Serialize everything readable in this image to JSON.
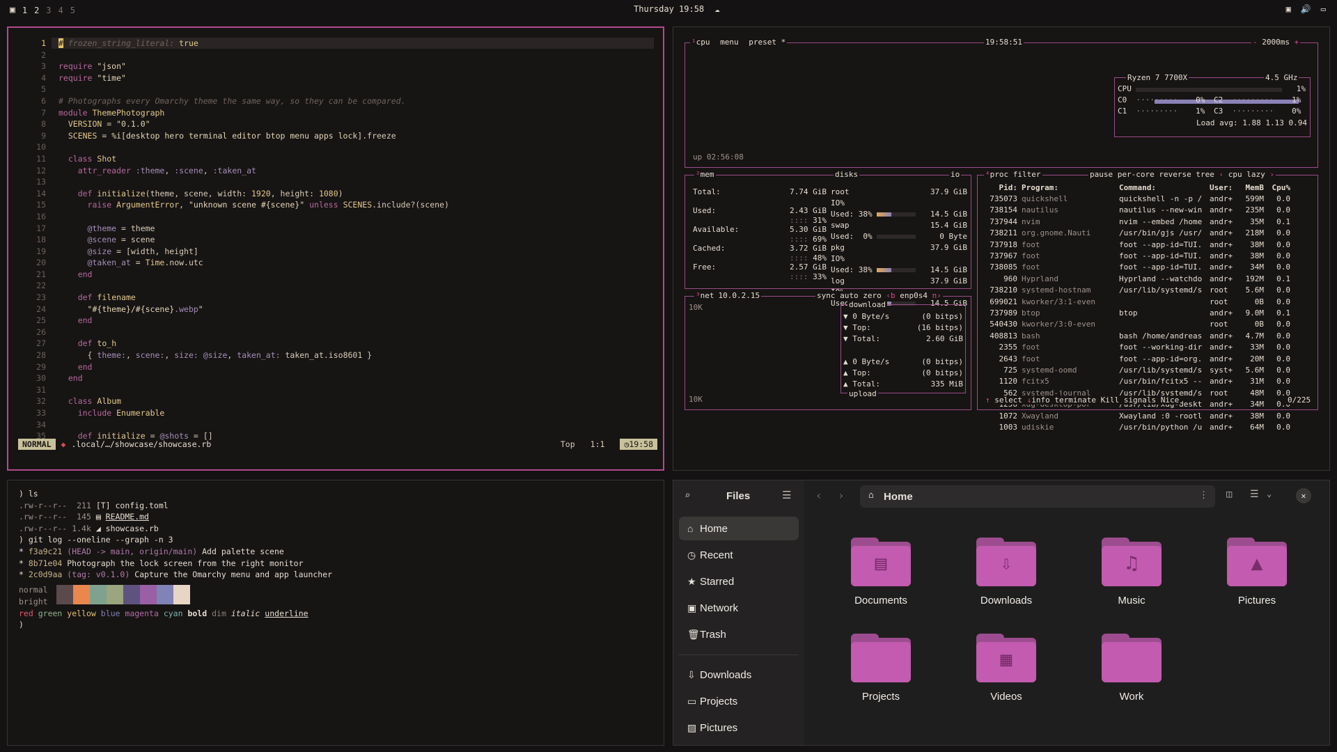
{
  "topbar": {
    "workspaces": [
      "1",
      "2",
      "3",
      "4",
      "5"
    ],
    "clock": "Thursday 19:58"
  },
  "editor": {
    "lines": [
      {
        "n": "1",
        "html": "<span class=\"cm\"># frozen_string_literal:</span> <span class=\"const\">true</span>"
      },
      {
        "n": "2",
        "html": ""
      },
      {
        "n": "3",
        "html": "<span class=\"kw\">require</span> <span class=\"str\">\"json\"</span>"
      },
      {
        "n": "4",
        "html": "<span class=\"kw\">require</span> <span class=\"str\">\"time\"</span>"
      },
      {
        "n": "5",
        "html": ""
      },
      {
        "n": "6",
        "html": "<span class=\"cm\"># Photographs every Omarchy theme the same way, so they can be compared.</span>"
      },
      {
        "n": "7",
        "html": "<span class=\"kw\">module</span> <span class=\"fn\">ThemePhotograph</span>"
      },
      {
        "n": "8",
        "html": "  <span class=\"const\">VERSION</span> = <span class=\"str\">\"0.1.0\"</span>"
      },
      {
        "n": "9",
        "html": "  <span class=\"const\">SCENES</span> = <span class=\"str\">%i[desktop hero terminal editor btop menu apps lock]</span>.freeze"
      },
      {
        "n": "10",
        "html": ""
      },
      {
        "n": "11",
        "html": "  <span class=\"kw\">class</span> <span class=\"fn\">Shot</span>"
      },
      {
        "n": "12",
        "html": "    <span class=\"kw\">attr_reader</span> <span class=\"iv\">:theme</span>, <span class=\"iv\">:scene</span>, <span class=\"iv\">:taken_at</span>"
      },
      {
        "n": "13",
        "html": ""
      },
      {
        "n": "14",
        "html": "    <span class=\"kw\">def</span> <span class=\"fn\">initialize</span>(theme, scene, width: <span class=\"const\">1920</span>, height: <span class=\"const\">1080</span>)"
      },
      {
        "n": "15",
        "html": "      <span class=\"kw\">raise</span> <span class=\"fn\">ArgumentError</span>, <span class=\"str\">\"unknown scene #{scene}\"</span> <span class=\"kw\">unless</span> <span class=\"const\">SCENES</span>.include?(scene)"
      },
      {
        "n": "16",
        "html": ""
      },
      {
        "n": "17",
        "html": "      <span class=\"iv\">@theme</span> = theme"
      },
      {
        "n": "18",
        "html": "      <span class=\"iv\">@scene</span> = scene"
      },
      {
        "n": "19",
        "html": "      <span class=\"iv\">@size</span> = [width, height]"
      },
      {
        "n": "20",
        "html": "      <span class=\"iv\">@taken_at</span> = <span class=\"fn\">Time</span>.now.utc"
      },
      {
        "n": "21",
        "html": "    <span class=\"kw\">end</span>"
      },
      {
        "n": "22",
        "html": ""
      },
      {
        "n": "23",
        "html": "    <span class=\"kw\">def</span> <span class=\"fn\">filename</span>"
      },
      {
        "n": "24",
        "html": "      <span class=\"str\">\"#{theme}/#{scene}</span><span class=\"iv\">.webp</span><span class=\"str\">\"</span>"
      },
      {
        "n": "25",
        "html": "    <span class=\"kw\">end</span>"
      },
      {
        "n": "26",
        "html": ""
      },
      {
        "n": "27",
        "html": "    <span class=\"kw\">def</span> <span class=\"fn\">to_h</span>"
      },
      {
        "n": "28",
        "html": "      { <span class=\"iv\">theme:</span>, <span class=\"iv\">scene:</span>, <span class=\"iv\">size:</span> <span class=\"iv\">@size</span>, <span class=\"iv\">taken_at:</span> taken_at.iso8601 }"
      },
      {
        "n": "29",
        "html": "    <span class=\"kw\">end</span>"
      },
      {
        "n": "30",
        "html": "  <span class=\"kw\">end</span>"
      },
      {
        "n": "31",
        "html": ""
      },
      {
        "n": "32",
        "html": "  <span class=\"kw\">class</span> <span class=\"fn\">Album</span>"
      },
      {
        "n": "33",
        "html": "    <span class=\"kw\">include</span> <span class=\"fn\">Enumerable</span>"
      },
      {
        "n": "34",
        "html": ""
      },
      {
        "n": "35",
        "html": "    <span class=\"kw\">def</span> <span class=\"fn\">initialize</span> = <span class=\"iv\">@shots</span> = []"
      }
    ],
    "status": {
      "mode": "NORMAL",
      "path": ".local/…/showcase/showcase.rb",
      "position": "Top",
      "cursor": "1:1",
      "time": "19:58"
    }
  },
  "btop": {
    "header": {
      "cpu": "cpu",
      "menu": "menu",
      "preset": "preset *",
      "clock": "19:58:51",
      "interval": "2000ms"
    },
    "uptime": "up 02:56:08",
    "cpu": {
      "model": "Ryzen 7 7700X",
      "freq": "4.5 GHz",
      "total_label": "CPU",
      "total_pct": "1%",
      "total_fill": 0.99,
      "cores": [
        {
          "name": "C0",
          "pct": "0%"
        },
        {
          "name": "C1",
          "pct": "1%"
        },
        {
          "name": "C2",
          "pct": "1%"
        },
        {
          "name": "C3",
          "pct": "0%"
        }
      ],
      "load": "Load avg: 1.88 1.13 0.94"
    },
    "mem": {
      "title": "mem",
      "rows": [
        {
          "k": "Total:",
          "v": "7.74 GiB"
        },
        {
          "k": "Used:",
          "v": "2.43 GiB",
          "p": "31%"
        },
        {
          "k": "Available:",
          "v": "5.30 GiB",
          "p": "69%"
        },
        {
          "k": "Cached:",
          "v": "3.72 GiB",
          "p": "48%"
        },
        {
          "k": "Free:",
          "v": "2.57 GiB",
          "p": "33%"
        }
      ]
    },
    "disks": {
      "title": "disks",
      "io_label": "io",
      "groups": [
        {
          "name": "root",
          "size": "37.9 GiB",
          "io": "IO%",
          "used": "Used: 38%",
          "usedv": "14.5 GiB",
          "fill": 0.38
        },
        {
          "name": "swap",
          "size": "15.4 GiB",
          "io": "",
          "used": "Used:  0%",
          "usedv": "0 Byte",
          "fill": 0.0
        },
        {
          "name": "pkg",
          "size": "37.9 GiB",
          "io": "IO%",
          "used": "Used: 38%",
          "usedv": "14.5 GiB",
          "fill": 0.38
        },
        {
          "name": "log",
          "size": "37.9 GiB",
          "io": "IO%",
          "used": "Used: 38%",
          "usedv": "14.5 GiB",
          "fill": 0.38
        }
      ]
    },
    "net": {
      "title": "net",
      "addr": "10.0.2.15",
      "opts": [
        "sync",
        "auto",
        "zero"
      ],
      "iface": "enp0s4",
      "scale_top": "10K",
      "scale_bottom": "10K",
      "download": {
        "label": "download",
        "rate": "0 Byte/s",
        "bits": "(0 bitps)",
        "top": "(16 bitps)",
        "total": "2.60 GiB"
      },
      "upload": {
        "label": "upload",
        "rate": "0 Byte/s",
        "bits": "(0 bitps)",
        "top": "(0 bitps)",
        "total": "335 MiB"
      }
    },
    "proc": {
      "title": "proc",
      "filter": "filter",
      "opts": [
        "pause",
        "per-core",
        "reverse",
        "tree",
        "cpu lazy"
      ],
      "headers": [
        "Pid:",
        "Program:",
        "Command:",
        "User:",
        "MemB",
        "Cpu%"
      ],
      "rows": [
        [
          "735073",
          "quickshell",
          "quickshell -n -p /",
          "andr+",
          "599M",
          "0.0"
        ],
        [
          "738154",
          "nautilus",
          "nautilus --new-win",
          "andr+",
          "235M",
          "0.0"
        ],
        [
          "737944",
          "nvim",
          "nvim --embed /home",
          "andr+",
          "35M",
          "0.1"
        ],
        [
          "738211",
          "org.gnome.Nauti",
          "/usr/bin/gjs /usr/",
          "andr+",
          "218M",
          "0.0"
        ],
        [
          "737918",
          "foot",
          "foot --app-id=TUI.",
          "andr+",
          "38M",
          "0.0"
        ],
        [
          "737967",
          "foot",
          "foot --app-id=TUI.",
          "andr+",
          "38M",
          "0.0"
        ],
        [
          "738085",
          "foot",
          "foot --app-id=TUI.",
          "andr+",
          "34M",
          "0.0"
        ],
        [
          "960",
          "Hyprland",
          "Hyprland --watchdo",
          "andr+",
          "192M",
          "0.1"
        ],
        [
          "738210",
          "systemd-hostnam",
          "/usr/lib/systemd/s",
          "root",
          "5.6M",
          "0.0"
        ],
        [
          "699021",
          "kworker/3:1-even",
          "",
          "root",
          "0B",
          "0.0"
        ],
        [
          "737989",
          "btop",
          "btop",
          "andr+",
          "9.0M",
          "0.1"
        ],
        [
          "540430",
          "kworker/3:0-even",
          "",
          "root",
          "0B",
          "0.0"
        ],
        [
          "408813",
          "bash",
          "bash /home/andreas",
          "andr+",
          "4.7M",
          "0.0"
        ],
        [
          "2355",
          "foot",
          "foot --working-dir",
          "andr+",
          "33M",
          "0.0"
        ],
        [
          "2643",
          "foot",
          "foot --app-id=org.",
          "andr+",
          "20M",
          "0.0"
        ],
        [
          "725",
          "systemd-oomd",
          "/usr/lib/systemd/s",
          "syst+",
          "5.6M",
          "0.0"
        ],
        [
          "1120",
          "fcitx5",
          "/usr/bin/fcitx5 --",
          "andr+",
          "31M",
          "0.0"
        ],
        [
          "562",
          "systemd-journal",
          "/usr/lib/systemd/s",
          "root",
          "48M",
          "0.0"
        ],
        [
          "1256",
          "xdg-desktop-por",
          "/usr/lib/xdg-deskt",
          "andr+",
          "34M",
          "0.0"
        ],
        [
          "1072",
          "Xwayland",
          "Xwayland :0 -rootl",
          "andr+",
          "38M",
          "0.0"
        ],
        [
          "1003",
          "udiskie",
          "/usr/bin/python /u",
          "andr+",
          "64M",
          "0.0"
        ]
      ],
      "footer": {
        "select": "select",
        "info": "info",
        "terminate": "terminate",
        "kill": "Kill",
        "signals": "signals",
        "nice": "Nice",
        "count": "0/225"
      }
    }
  },
  "terminal": {
    "lines": [
      "<span style=\"color:#e6ddd0\">) ls</span>",
      "<span class=\"muted\">.rw-r--r--</span>  <span class=\"muted\">211</span> [T] config.toml",
      "<span class=\"muted\">.rw-r--r--</span>  <span class=\"muted\">145</span> ▤ <u>README.md</u>",
      "<span class=\"muted\">.rw-r--r--</span> <span class=\"muted\">1.4k</span> ◢ showcase.rb",
      ") git log --oneline --graph -n 3",
      "* <span style=\"color:#c9b58a\">f3a9c21</span> <span style=\"color:#b07aa8\">(HEAD -&gt; main, origin/main)</span> Add palette scene",
      "* <span style=\"color:#c9b58a\">8b71e04</span> Photograph the lock screen from the right monitor",
      "* <span style=\"color:#c9b58a\">2c0d9aa</span> <span style=\"color:#b07aa8\">(tag: v0.1.0)</span> Capture the Omarchy menu and app launcher"
    ],
    "palette_normal_label": "normal",
    "palette_bright_label": "bright",
    "palette_colors": [
      "#5a4a4c",
      "#e9874f",
      "#7fa28e",
      "#9ba57e",
      "#5e5380",
      "#9a5fa4",
      "#7f83b7",
      "#e8d5c5"
    ],
    "styles_line": "<span style=\"color:#e05a6a\">red</span> <span style=\"color:#8fb48a\">green</span> <span style=\"color:#e3c16e\">yellow</span> <span style=\"color:#7f83b7\">blue</span> <span style=\"color:#b66aa8\">magenta</span> <span style=\"color:#7ab3b0\">cyan</span> <b>bold</b> <span style=\"color:#8a7f78\">dim</span> <i>italic</i> <u>underline</u>",
    "prompt": ")"
  },
  "files": {
    "title": "Files",
    "location": "Home",
    "sidebar": [
      {
        "label": "Home",
        "icon": "⌂",
        "name": "home",
        "active": true
      },
      {
        "label": "Recent",
        "icon": "◷",
        "name": "recent"
      },
      {
        "label": "Starred",
        "icon": "★",
        "name": "starred"
      },
      {
        "label": "Network",
        "icon": "▣",
        "name": "network"
      },
      {
        "label": "Trash",
        "icon": "🗑",
        "name": "trash"
      },
      {
        "label": "Downloads",
        "icon": "⇩",
        "name": "downloads"
      },
      {
        "label": "Projects",
        "icon": "▭",
        "name": "projects"
      },
      {
        "label": "Pictures",
        "icon": "▨",
        "name": "pictures"
      }
    ],
    "folders": [
      {
        "label": "Documents",
        "glyph": "▤"
      },
      {
        "label": "Downloads",
        "glyph": "⇩"
      },
      {
        "label": "Music",
        "glyph": "♫"
      },
      {
        "label": "Pictures",
        "glyph": "▲"
      },
      {
        "label": "Projects",
        "glyph": ""
      },
      {
        "label": "Videos",
        "glyph": "▦"
      },
      {
        "label": "Work",
        "glyph": ""
      }
    ]
  }
}
